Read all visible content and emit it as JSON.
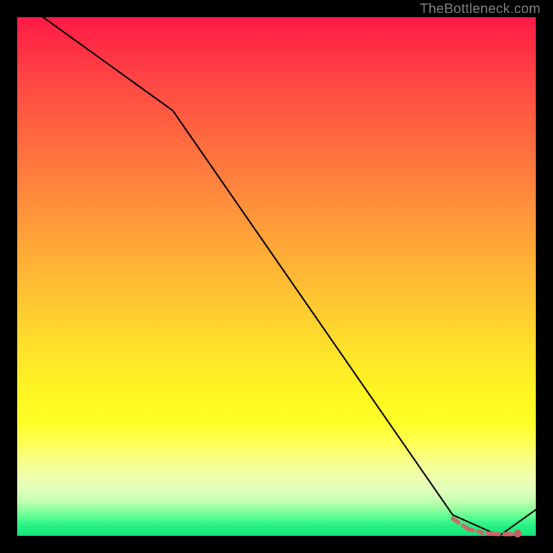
{
  "attribution": "TheBottleneck.com",
  "colors": {
    "page_bg": "#000000",
    "line": "#000000",
    "dash": "#cc6a6a",
    "dot": "#c85f5f",
    "attribution_text": "#808080"
  },
  "chart_data": {
    "type": "line",
    "title": "",
    "xlabel": "",
    "ylabel": "",
    "xlim": [
      0,
      100
    ],
    "ylim": [
      0,
      100
    ],
    "series": [
      {
        "name": "main-curve",
        "style": "solid",
        "x": [
          5,
          30,
          84,
          93,
          100
        ],
        "y": [
          100,
          82,
          4,
          0,
          5
        ]
      },
      {
        "name": "dashed-valley",
        "style": "dashed",
        "x": [
          84,
          87,
          90,
          93,
          96
        ],
        "y": [
          3.3,
          1.3,
          0.5,
          0.3,
          0.3
        ]
      }
    ],
    "markers": [
      {
        "name": "end-dot",
        "x": 96.5,
        "y": 0.4
      }
    ],
    "grid": false,
    "legend": false
  }
}
